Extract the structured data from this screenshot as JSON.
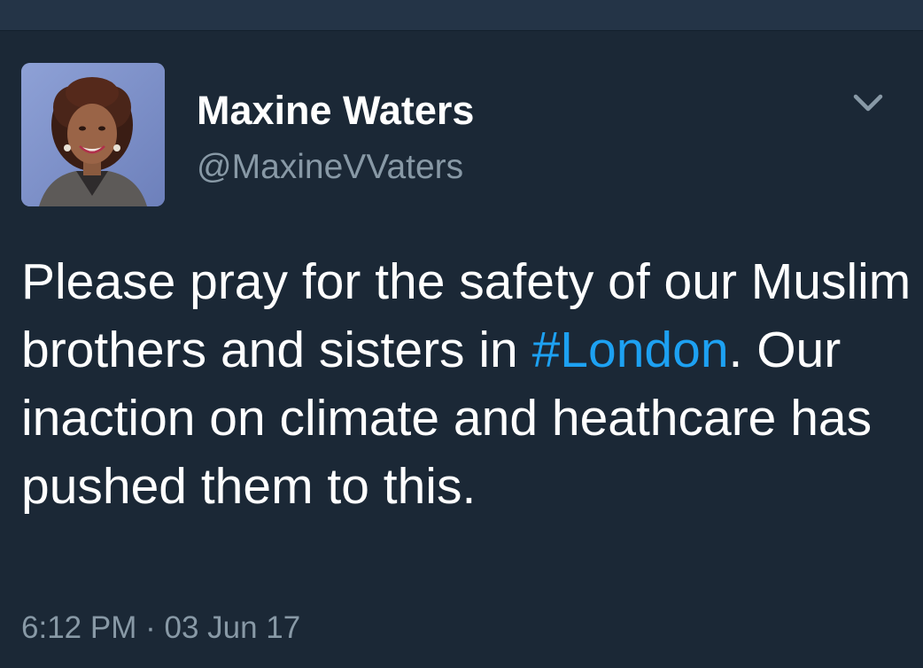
{
  "tweet": {
    "display_name": "Maxine Waters",
    "handle": "@MaxineVVaters",
    "text_part1": "Please pray for the safety of our Muslim brothers and sisters in ",
    "hashtag": "#London",
    "text_part2": ". Our inaction on climate and heathcare has pushed them to this.",
    "time": "6:12 PM",
    "separator": "·",
    "date": "03 Jun 17",
    "avatar_icon": "profile-photo",
    "menu_icon": "chevron-down-icon"
  },
  "colors": {
    "background": "#1b2836",
    "topbar": "#243447",
    "text": "#ffffff",
    "secondary_text": "#8899a6",
    "link": "#1da1f2"
  }
}
